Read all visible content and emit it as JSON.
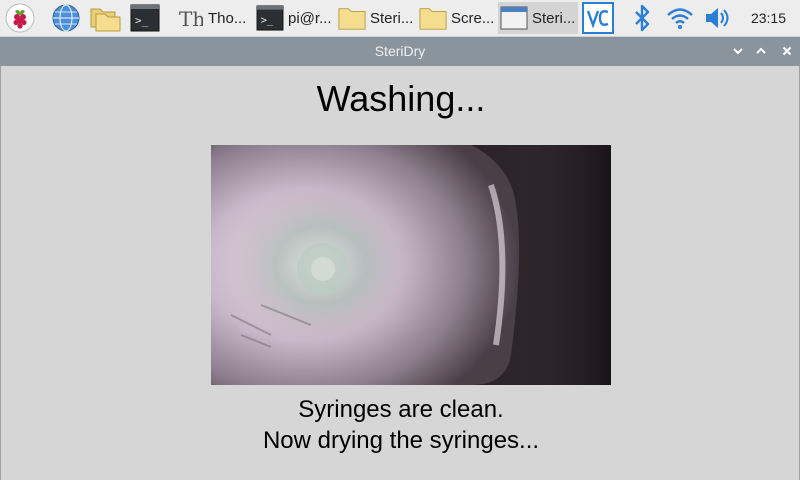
{
  "taskbar": {
    "launchers": [
      {
        "icon": "raspberry-menu-icon"
      },
      {
        "icon": "web-browser-icon"
      },
      {
        "icon": "file-manager-icon"
      },
      {
        "icon": "terminal-icon"
      }
    ],
    "tasks": [
      {
        "label": "Tho...",
        "icon": "thonny-icon",
        "active": false
      },
      {
        "label": "pi@r...",
        "icon": "terminal-icon",
        "active": false
      },
      {
        "label": "Steri...",
        "icon": "folder-icon",
        "active": false
      },
      {
        "label": "Scre...",
        "icon": "folder-icon",
        "active": false
      },
      {
        "label": "Steri...",
        "icon": "window-icon",
        "active": true
      }
    ],
    "tray": [
      {
        "icon": "vnc-icon"
      },
      {
        "icon": "bluetooth-icon"
      },
      {
        "icon": "wifi-icon"
      },
      {
        "icon": "volume-icon"
      }
    ],
    "clock": "23:15"
  },
  "window": {
    "title": "SteriDry",
    "controls": [
      "minimize",
      "maximize",
      "close"
    ]
  },
  "main": {
    "status_heading": "Washing...",
    "message_line1": "Syringes are clean.",
    "message_line2": "Now drying the syringes..."
  },
  "colors": {
    "taskbar_bg": "#ededed",
    "titlebar_bg": "#8a949c",
    "content_bg": "#d6d6d6",
    "accent_blue": "#2a7fd4"
  }
}
